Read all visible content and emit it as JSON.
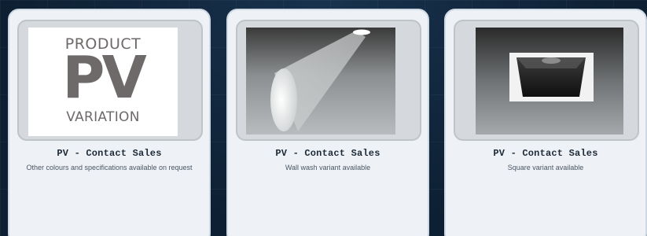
{
  "cards": [
    {
      "title": "PV - Contact Sales",
      "description": "Other colours and specifications available on request",
      "image": {
        "logo_top": "PRODUCT",
        "logo_main": "PV",
        "logo_bottom": "VARIATION"
      }
    },
    {
      "title": "PV - Contact Sales",
      "description": "Wall wash variant available",
      "image": {
        "icon": "wall-wash-light-icon"
      }
    },
    {
      "title": "PV - Contact Sales",
      "description": "Square variant available",
      "image": {
        "icon": "square-downlight-icon"
      }
    }
  ],
  "colors": {
    "page_background": "#0f2236",
    "card_background": "#eef2f6",
    "card_border": "#cfd9e3",
    "logo_gray": "#6e6a69"
  }
}
